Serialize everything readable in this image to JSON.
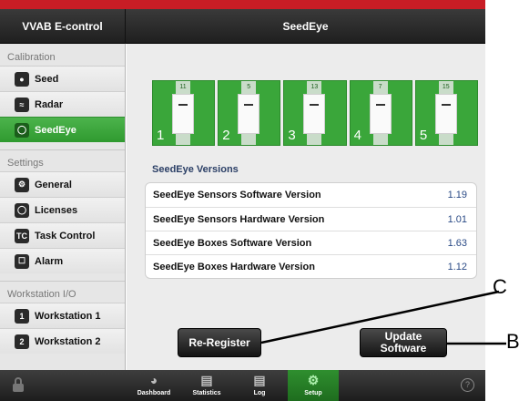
{
  "app": {
    "sidebar_title": "VVAB E-control",
    "page_title": "SeedEye"
  },
  "sidebar": {
    "sections": [
      {
        "title": "Calibration",
        "items": [
          {
            "label": "Seed",
            "icon": "seed-icon"
          },
          {
            "label": "Radar",
            "icon": "radar-icon"
          },
          {
            "label": "SeedEye",
            "icon": "seedeye-icon",
            "active": true
          }
        ]
      },
      {
        "title": "Settings",
        "items": [
          {
            "label": "General",
            "icon": "general-icon"
          },
          {
            "label": "Licenses",
            "icon": "licenses-icon"
          },
          {
            "label": "Task Control",
            "icon": "task-control-icon",
            "badge": "TC"
          },
          {
            "label": "Alarm",
            "icon": "alarm-icon"
          }
        ]
      },
      {
        "title": "Workstation I/O",
        "items": [
          {
            "label": "Workstation 1",
            "icon": "workstation-1-icon",
            "badge": "1"
          },
          {
            "label": "Workstation 2",
            "icon": "workstation-2-icon",
            "badge": "2"
          }
        ]
      }
    ]
  },
  "seedeye": {
    "units": [
      {
        "number": "1",
        "sensor_count": "11"
      },
      {
        "number": "2",
        "sensor_count": "5"
      },
      {
        "number": "3",
        "sensor_count": "13"
      },
      {
        "number": "4",
        "sensor_count": "7"
      },
      {
        "number": "5",
        "sensor_count": "15"
      }
    ],
    "versions_title": "SeedEye Versions",
    "versions": [
      {
        "label": "SeedEye Sensors Software Version",
        "value": "1.19"
      },
      {
        "label": "SeedEye Sensors Hardware Version",
        "value": "1.01"
      },
      {
        "label": "SeedEye Boxes Software Version",
        "value": "1.63"
      },
      {
        "label": "SeedEye Boxes Hardware Version",
        "value": "1.12"
      }
    ]
  },
  "buttons": {
    "reregister": "Re-Register",
    "update_line1": "Update",
    "update_line2": "Software"
  },
  "tabbar": {
    "tabs": [
      {
        "label": "Dashboard",
        "icon": "dashboard-icon"
      },
      {
        "label": "Statistics",
        "icon": "statistics-icon"
      },
      {
        "label": "Log",
        "icon": "log-icon"
      },
      {
        "label": "Setup",
        "icon": "setup-icon",
        "active": true
      }
    ],
    "help": "?"
  },
  "annotations": {
    "c": "C",
    "b": "B"
  },
  "colors": {
    "accent_green": "#3aa63a",
    "header_red": "#c81d25",
    "dark_bar": "#1f1f1f"
  }
}
